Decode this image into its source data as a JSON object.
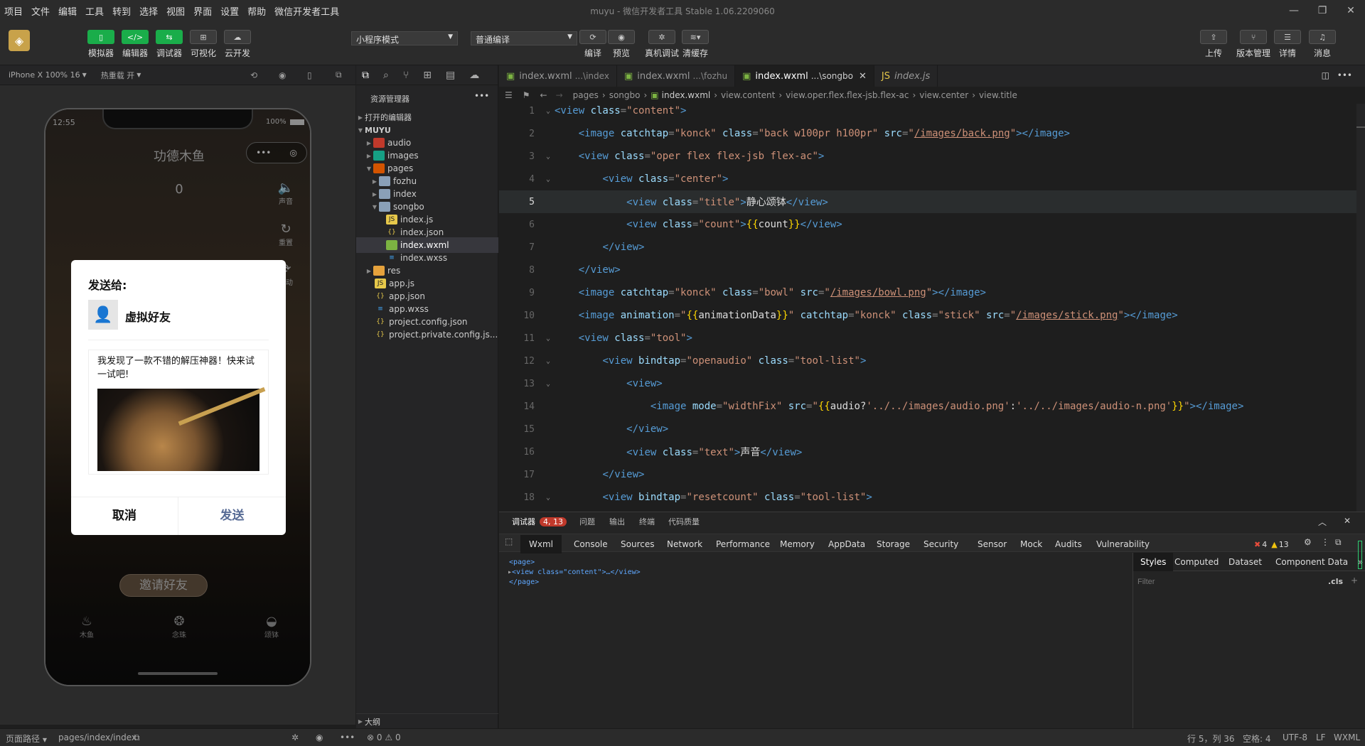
{
  "menu": {
    "items": [
      "项目",
      "文件",
      "编辑",
      "工具",
      "转到",
      "选择",
      "视图",
      "界面",
      "设置",
      "帮助",
      "微信开发者工具"
    ],
    "window_title": "muyu - 微信开发者工具 Stable 1.06.2209060"
  },
  "toolbar": {
    "simulator": "模拟器",
    "editor": "编辑器",
    "debugger": "调试器",
    "visual": "可视化",
    "cloud": "云开发",
    "mode_select": "小程序模式",
    "compile_select": "普通编译",
    "compile": "编译",
    "preview": "预览",
    "real_debug": "真机调试",
    "clear_cache": "清缓存",
    "upload": "上传",
    "version": "版本管理",
    "details": "详情",
    "messages": "消息"
  },
  "simbar": {
    "device": "iPhone X 100% 16",
    "hot_reload": "热重载 开"
  },
  "phone": {
    "time": "12:55",
    "battery": "100%",
    "nav_title": "功德木鱼",
    "count": "0",
    "side_sound": "声音",
    "side_reset": "重置",
    "side_auto": "自动",
    "invite": "邀请好友",
    "tab_muyu": "木鱼",
    "tab_beads": "念珠",
    "tab_bowl": "颂钵"
  },
  "share_dialog": {
    "send_to": "发送给:",
    "friend": "虚拟好友",
    "message": "我发现了一款不错的解压神器！快来试一试吧!",
    "cancel": "取消",
    "send": "发送"
  },
  "explorer": {
    "title": "资源管理器",
    "open_editors": "打开的编辑器",
    "project": "MUYU",
    "items": [
      {
        "name": "audio",
        "icon": "folder-audio"
      },
      {
        "name": "images",
        "icon": "folder-images"
      },
      {
        "name": "pages",
        "icon": "folder-open"
      },
      {
        "name": "fozhu",
        "icon": "folder"
      },
      {
        "name": "index",
        "icon": "folder"
      },
      {
        "name": "songbo",
        "icon": "folder-open"
      },
      {
        "name": "index.js",
        "icon": "js-file"
      },
      {
        "name": "index.json",
        "icon": "json-file"
      },
      {
        "name": "index.wxml",
        "icon": "wxml-file"
      },
      {
        "name": "index.wxss",
        "icon": "wxss-file"
      },
      {
        "name": "res",
        "icon": "folder"
      },
      {
        "name": "app.js",
        "icon": "js-file"
      },
      {
        "name": "app.json",
        "icon": "json-file"
      },
      {
        "name": "app.wxss",
        "icon": "wxss-file"
      },
      {
        "name": "project.config.json",
        "icon": "json-file"
      },
      {
        "name": "project.private.config.js...",
        "icon": "json-file"
      }
    ],
    "outline": "大纲"
  },
  "editor": {
    "tabs": [
      {
        "name": "index.wxml",
        "sub": "...\\index"
      },
      {
        "name": "index.wxml",
        "sub": "...\\fozhu"
      },
      {
        "name": "index.wxml",
        "sub": "...\\songbo"
      },
      {
        "name": "index.js",
        "sub": ""
      }
    ],
    "breadcrumbs": [
      "pages",
      "songbo",
      "index.wxml",
      "view.content",
      "view.oper.flex.flex-jsb.flex-ac",
      "view.center",
      "view.title"
    ],
    "lines": [
      {
        "n": "1",
        "parts": [
          [
            "t",
            "<view "
          ],
          [
            "a",
            "class"
          ],
          [
            "p",
            "="
          ],
          [
            "s",
            "\"content\""
          ],
          [
            "t",
            ">"
          ]
        ]
      },
      {
        "n": "2",
        "parts": [
          [
            "w",
            "    "
          ],
          [
            "t",
            "<image "
          ],
          [
            "a",
            "catchtap"
          ],
          [
            "p",
            "="
          ],
          [
            "s",
            "\"konck\" "
          ],
          [
            "a",
            "class"
          ],
          [
            "p",
            "="
          ],
          [
            "s",
            "\"back w100pr h100pr\" "
          ],
          [
            "a",
            "src"
          ],
          [
            "p",
            "="
          ],
          [
            "s",
            "\""
          ],
          [
            "u",
            "/images/back.png"
          ],
          [
            "s",
            "\""
          ],
          [
            "t",
            "></image>"
          ]
        ]
      },
      {
        "n": "3",
        "parts": [
          [
            "w",
            "    "
          ],
          [
            "t",
            "<view "
          ],
          [
            "a",
            "class"
          ],
          [
            "p",
            "="
          ],
          [
            "s",
            "\"oper flex flex-jsb flex-ac\""
          ],
          [
            "t",
            ">"
          ]
        ]
      },
      {
        "n": "4",
        "parts": [
          [
            "w",
            "        "
          ],
          [
            "t",
            "<view "
          ],
          [
            "a",
            "class"
          ],
          [
            "p",
            "="
          ],
          [
            "s",
            "\"center\""
          ],
          [
            "t",
            ">"
          ]
        ]
      },
      {
        "n": "5",
        "parts": [
          [
            "w",
            "            "
          ],
          [
            "t",
            "<view "
          ],
          [
            "a",
            "class"
          ],
          [
            "p",
            "="
          ],
          [
            "s",
            "\"title\""
          ],
          [
            "t",
            ">"
          ],
          [
            "w",
            "静心颂钵"
          ],
          [
            "t",
            "</view>"
          ]
        ]
      },
      {
        "n": "6",
        "parts": [
          [
            "w",
            "            "
          ],
          [
            "t",
            "<view "
          ],
          [
            "a",
            "class"
          ],
          [
            "p",
            "="
          ],
          [
            "s",
            "\"count\""
          ],
          [
            "t",
            ">"
          ],
          [
            "b",
            "{{"
          ],
          [
            "w",
            "count"
          ],
          [
            "b",
            "}}"
          ],
          [
            "t",
            "</view>"
          ]
        ]
      },
      {
        "n": "7",
        "parts": [
          [
            "w",
            "        "
          ],
          [
            "t",
            "</view>"
          ]
        ]
      },
      {
        "n": "8",
        "parts": [
          [
            "w",
            "    "
          ],
          [
            "t",
            "</view>"
          ]
        ]
      },
      {
        "n": "9",
        "parts": [
          [
            "w",
            "    "
          ],
          [
            "t",
            "<image "
          ],
          [
            "a",
            "catchtap"
          ],
          [
            "p",
            "="
          ],
          [
            "s",
            "\"konck\" "
          ],
          [
            "a",
            "class"
          ],
          [
            "p",
            "="
          ],
          [
            "s",
            "\"bowl\" "
          ],
          [
            "a",
            "src"
          ],
          [
            "p",
            "="
          ],
          [
            "s",
            "\""
          ],
          [
            "u",
            "/images/bowl.png"
          ],
          [
            "s",
            "\""
          ],
          [
            "t",
            "></image>"
          ]
        ]
      },
      {
        "n": "10",
        "parts": [
          [
            "w",
            "    "
          ],
          [
            "t",
            "<image "
          ],
          [
            "a",
            "animation"
          ],
          [
            "p",
            "="
          ],
          [
            "s",
            "\""
          ],
          [
            "b",
            "{{"
          ],
          [
            "w",
            "animationData"
          ],
          [
            "b",
            "}}"
          ],
          [
            "s",
            "\" "
          ],
          [
            "a",
            "catchtap"
          ],
          [
            "p",
            "="
          ],
          [
            "s",
            "\"konck\" "
          ],
          [
            "a",
            "class"
          ],
          [
            "p",
            "="
          ],
          [
            "s",
            "\"stick\" "
          ],
          [
            "a",
            "src"
          ],
          [
            "p",
            "="
          ],
          [
            "s",
            "\""
          ],
          [
            "u",
            "/images/stick.png"
          ],
          [
            "s",
            "\""
          ],
          [
            "t",
            "></image>"
          ]
        ]
      },
      {
        "n": "11",
        "parts": [
          [
            "w",
            "    "
          ],
          [
            "t",
            "<view "
          ],
          [
            "a",
            "class"
          ],
          [
            "p",
            "="
          ],
          [
            "s",
            "\"tool\""
          ],
          [
            "t",
            ">"
          ]
        ]
      },
      {
        "n": "12",
        "parts": [
          [
            "w",
            "        "
          ],
          [
            "t",
            "<view "
          ],
          [
            "a",
            "bindtap"
          ],
          [
            "p",
            "="
          ],
          [
            "s",
            "\"openaudio\" "
          ],
          [
            "a",
            "class"
          ],
          [
            "p",
            "="
          ],
          [
            "s",
            "\"tool-list\""
          ],
          [
            "t",
            ">"
          ]
        ]
      },
      {
        "n": "13",
        "parts": [
          [
            "w",
            "            "
          ],
          [
            "t",
            "<view>"
          ]
        ]
      },
      {
        "n": "14",
        "parts": [
          [
            "w",
            "                "
          ],
          [
            "t",
            "<image "
          ],
          [
            "a",
            "mode"
          ],
          [
            "p",
            "="
          ],
          [
            "s",
            "\"widthFix\" "
          ],
          [
            "a",
            "src"
          ],
          [
            "p",
            "="
          ],
          [
            "s",
            "\""
          ],
          [
            "b",
            "{{"
          ],
          [
            "w",
            "audio?"
          ],
          [
            "s",
            "'../../images/audio.png'"
          ],
          [
            "w",
            ":"
          ],
          [
            "s",
            "'../../images/audio-n.png'"
          ],
          [
            "b",
            "}}"
          ],
          [
            "s",
            "\""
          ],
          [
            "t",
            "></image>"
          ]
        ]
      },
      {
        "n": "15",
        "parts": [
          [
            "w",
            "            "
          ],
          [
            "t",
            "</view>"
          ]
        ]
      },
      {
        "n": "16",
        "parts": [
          [
            "w",
            "            "
          ],
          [
            "t",
            "<view "
          ],
          [
            "a",
            "class"
          ],
          [
            "p",
            "="
          ],
          [
            "s",
            "\"text\""
          ],
          [
            "t",
            ">"
          ],
          [
            "w",
            "声音"
          ],
          [
            "t",
            "</view>"
          ]
        ]
      },
      {
        "n": "17",
        "parts": [
          [
            "w",
            "        "
          ],
          [
            "t",
            "</view>"
          ]
        ]
      },
      {
        "n": "18",
        "parts": [
          [
            "w",
            "        "
          ],
          [
            "t",
            "<view "
          ],
          [
            "a",
            "bindtap"
          ],
          [
            "p",
            "="
          ],
          [
            "s",
            "\"resetcount\" "
          ],
          [
            "a",
            "class"
          ],
          [
            "p",
            "="
          ],
          [
            "s",
            "\"tool-list\""
          ],
          [
            "t",
            ">"
          ]
        ]
      }
    ]
  },
  "devtools": {
    "top_tabs": [
      "调试器",
      "问题",
      "输出",
      "终端",
      "代码质量"
    ],
    "badge": "4, 13",
    "panel_tabs": [
      "Wxml",
      "Console",
      "Sources",
      "Network",
      "Performance",
      "Memory",
      "AppData",
      "Storage",
      "Security",
      "Sensor",
      "Mock",
      "Audits",
      "Vulnerability"
    ],
    "errors": "4",
    "warnings": "13",
    "dom_lines": [
      "<page>",
      "<view class=\"content\">…</view>",
      "</page>"
    ],
    "style_tabs": [
      "Styles",
      "Computed",
      "Dataset",
      "Component Data"
    ],
    "filter_placeholder": "Filter",
    "cls": ".cls"
  },
  "statusbar": {
    "page_path_label": "页面路径",
    "page_path": "pages/index/index",
    "errors": "0",
    "warnings": "0",
    "cursor": "行 5，列 36",
    "spaces": "空格: 4",
    "encoding": "UTF-8",
    "eol": "LF",
    "lang": "WXML"
  }
}
